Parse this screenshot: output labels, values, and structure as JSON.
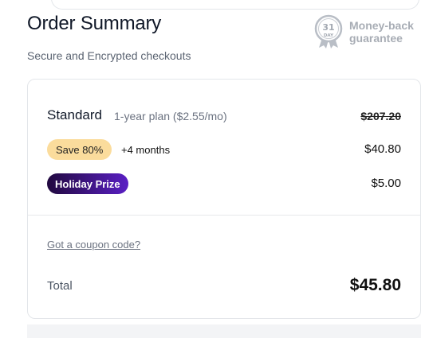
{
  "header": {
    "title": "Order Summary",
    "subtitle": "Secure and Encrypted checkouts"
  },
  "guarantee": {
    "days": "31",
    "day_label": "DAY",
    "line1": "Money-back",
    "line2": "guarantee",
    "icon": "seal-icon"
  },
  "plan": {
    "name": "Standard",
    "detail": "1-year plan ($2.55/mo)",
    "original_price": "$207.20"
  },
  "discount": {
    "badge": "Save 80%",
    "extra": "+4 months",
    "price": "$40.80",
    "badge_color": "#fbdc9c"
  },
  "holiday": {
    "badge": "Holiday Prize",
    "price": "$5.00",
    "gradient_start": "#21093f",
    "gradient_end": "#5a1fc4"
  },
  "coupon": {
    "link": "Got a coupon code?"
  },
  "total": {
    "label": "Total",
    "value": "$45.80"
  }
}
